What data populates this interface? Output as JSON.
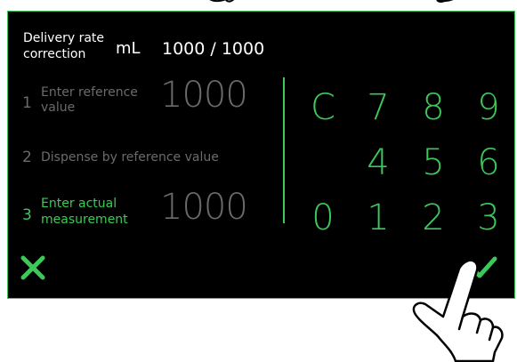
{
  "header": {
    "title_line1": "Delivery rate",
    "title_line2": "correction",
    "unit": "mL",
    "rate_value": "1000 / 1000"
  },
  "steps": [
    {
      "number": "1",
      "label_line1": "Enter reference",
      "label_line2": "value",
      "value": "1000",
      "state": "inactive"
    },
    {
      "number": "2",
      "label_line1": "Dispense by reference value",
      "state": "inactive"
    },
    {
      "number": "3",
      "label_line1": "Enter actual",
      "label_line2": "measurement",
      "value": "1000",
      "state": "active"
    }
  ],
  "keypad": {
    "rows": [
      [
        "C",
        "7",
        "8",
        "9"
      ],
      [
        "",
        "4",
        "5",
        "6"
      ],
      [
        "0",
        "1",
        "2",
        "3"
      ]
    ]
  },
  "actions": {
    "cancel_icon": "x-icon",
    "confirm_icon": "checkmark-icon"
  },
  "colors": {
    "accent": "#3cc95a",
    "background": "#000000",
    "inactive_text": "#6b6b6b",
    "text": "#ffffff"
  }
}
